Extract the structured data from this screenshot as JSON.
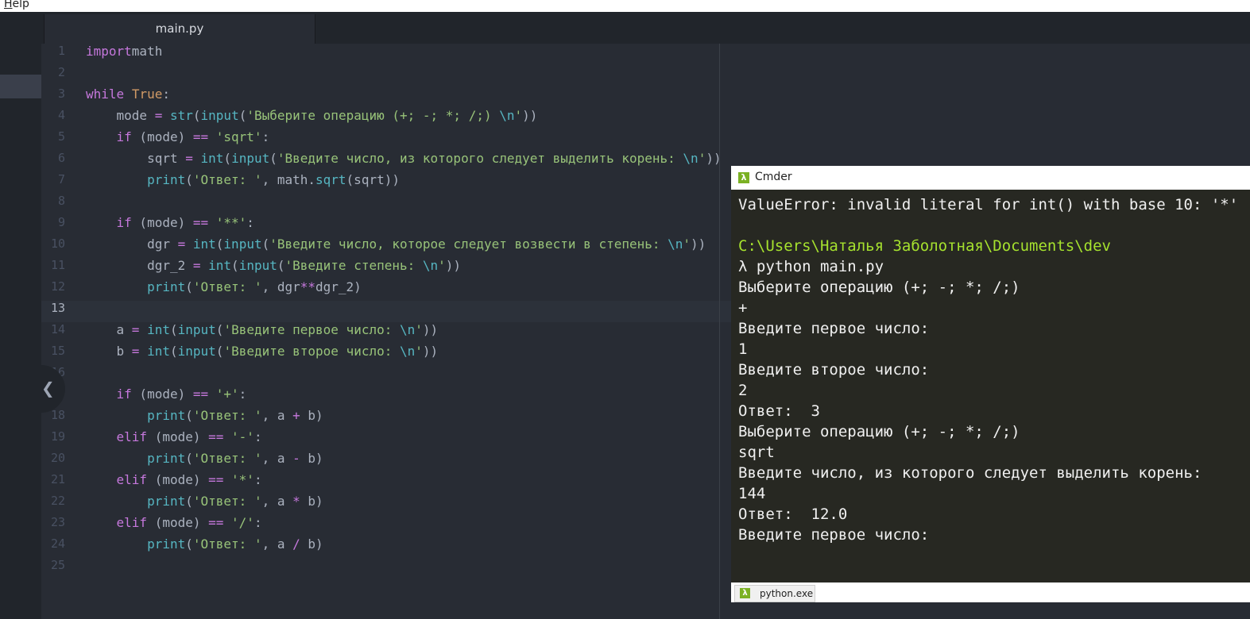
{
  "menubar": {
    "help_accel": "H",
    "help_rest": "elp"
  },
  "editor": {
    "tab_title": "main.py",
    "current_line": 13,
    "lines": [
      {
        "num": "1",
        "segs": [
          [
            "kw",
            "import"
          ],
          [
            "",
            "math"
          ]
        ]
      },
      {
        "num": "2",
        "segs": []
      },
      {
        "num": "3",
        "segs": [
          [
            "kw",
            "while"
          ],
          [
            "",
            " "
          ],
          [
            "cn",
            "True"
          ],
          [
            "",
            ":"
          ]
        ]
      },
      {
        "num": "4",
        "segs": [
          [
            "",
            "    mode "
          ],
          [
            "op",
            "="
          ],
          [
            "",
            " "
          ],
          [
            "bi",
            "str"
          ],
          [
            "",
            "("
          ],
          [
            "bi",
            "input"
          ],
          [
            "",
            "("
          ],
          [
            "st",
            "'Выберите операцию (+; -; *; /;) "
          ],
          [
            "es",
            "\\n"
          ],
          [
            "st",
            "'"
          ],
          [
            "",
            "))"
          ]
        ]
      },
      {
        "num": "5",
        "segs": [
          [
            "",
            "    "
          ],
          [
            "kw",
            "if"
          ],
          [
            "",
            " (mode) "
          ],
          [
            "op",
            "=="
          ],
          [
            "",
            " "
          ],
          [
            "st",
            "'sqrt'"
          ],
          [
            "",
            ":"
          ]
        ]
      },
      {
        "num": "6",
        "segs": [
          [
            "",
            "        sqrt "
          ],
          [
            "op",
            "="
          ],
          [
            "",
            " "
          ],
          [
            "bi",
            "int"
          ],
          [
            "",
            "("
          ],
          [
            "bi",
            "input"
          ],
          [
            "",
            "("
          ],
          [
            "st",
            "'Введите число, из которого следует выделить корень: "
          ],
          [
            "es",
            "\\n"
          ],
          [
            "st",
            "'"
          ],
          [
            "",
            "))"
          ]
        ]
      },
      {
        "num": "7",
        "segs": [
          [
            "",
            "        "
          ],
          [
            "bi",
            "print"
          ],
          [
            "",
            "("
          ],
          [
            "st",
            "'Ответ: '"
          ],
          [
            "",
            ", math."
          ],
          [
            "bi",
            "sqrt"
          ],
          [
            "",
            "(sqrt))"
          ]
        ]
      },
      {
        "num": "8",
        "segs": []
      },
      {
        "num": "9",
        "segs": [
          [
            "",
            "    "
          ],
          [
            "kw",
            "if"
          ],
          [
            "",
            " (mode) "
          ],
          [
            "op",
            "=="
          ],
          [
            "",
            " "
          ],
          [
            "st",
            "'**'"
          ],
          [
            "",
            ":"
          ]
        ]
      },
      {
        "num": "10",
        "segs": [
          [
            "",
            "        dgr "
          ],
          [
            "op",
            "="
          ],
          [
            "",
            " "
          ],
          [
            "bi",
            "int"
          ],
          [
            "",
            "("
          ],
          [
            "bi",
            "input"
          ],
          [
            "",
            "("
          ],
          [
            "st",
            "'Введите число, которое следует возвести в степень: "
          ],
          [
            "es",
            "\\n"
          ],
          [
            "st",
            "'"
          ],
          [
            "",
            "))"
          ]
        ]
      },
      {
        "num": "11",
        "segs": [
          [
            "",
            "        dgr_2 "
          ],
          [
            "op",
            "="
          ],
          [
            "",
            " "
          ],
          [
            "bi",
            "int"
          ],
          [
            "",
            "("
          ],
          [
            "bi",
            "input"
          ],
          [
            "",
            "("
          ],
          [
            "st",
            "'Введите степень: "
          ],
          [
            "es",
            "\\n"
          ],
          [
            "st",
            "'"
          ],
          [
            "",
            "))"
          ]
        ]
      },
      {
        "num": "12",
        "segs": [
          [
            "",
            "        "
          ],
          [
            "bi",
            "print"
          ],
          [
            "",
            "("
          ],
          [
            "st",
            "'Ответ: '"
          ],
          [
            "",
            ", dgr"
          ],
          [
            "op",
            "**"
          ],
          [
            "",
            "dgr_2)"
          ]
        ]
      },
      {
        "num": "13",
        "segs": []
      },
      {
        "num": "14",
        "segs": [
          [
            "",
            "    a "
          ],
          [
            "op",
            "="
          ],
          [
            "",
            " "
          ],
          [
            "bi",
            "int"
          ],
          [
            "",
            "("
          ],
          [
            "bi",
            "input"
          ],
          [
            "",
            "("
          ],
          [
            "st",
            "'Введите первое число: "
          ],
          [
            "es",
            "\\n"
          ],
          [
            "st",
            "'"
          ],
          [
            "",
            "))"
          ]
        ]
      },
      {
        "num": "15",
        "segs": [
          [
            "",
            "    b "
          ],
          [
            "op",
            "="
          ],
          [
            "",
            " "
          ],
          [
            "bi",
            "int"
          ],
          [
            "",
            "("
          ],
          [
            "bi",
            "input"
          ],
          [
            "",
            "("
          ],
          [
            "st",
            "'Введите вторoе число: "
          ],
          [
            "es",
            "\\n"
          ],
          [
            "st",
            "'"
          ],
          [
            "",
            "))"
          ]
        ]
      },
      {
        "num": "16",
        "segs": []
      },
      {
        "num": "17",
        "segs": [
          [
            "",
            "    "
          ],
          [
            "kw",
            "if"
          ],
          [
            "",
            " (mode) "
          ],
          [
            "op",
            "=="
          ],
          [
            "",
            " "
          ],
          [
            "st",
            "'+'"
          ],
          [
            "",
            ":"
          ]
        ]
      },
      {
        "num": "18",
        "segs": [
          [
            "",
            "        "
          ],
          [
            "bi",
            "print"
          ],
          [
            "",
            "("
          ],
          [
            "st",
            "'Ответ: '"
          ],
          [
            "",
            ", a "
          ],
          [
            "op",
            "+"
          ],
          [
            "",
            " b)"
          ]
        ]
      },
      {
        "num": "19",
        "segs": [
          [
            "",
            "    "
          ],
          [
            "kw",
            "elif"
          ],
          [
            "",
            " (mode) "
          ],
          [
            "op",
            "=="
          ],
          [
            "",
            " "
          ],
          [
            "st",
            "'-'"
          ],
          [
            "",
            ":"
          ]
        ]
      },
      {
        "num": "20",
        "segs": [
          [
            "",
            "        "
          ],
          [
            "bi",
            "print"
          ],
          [
            "",
            "("
          ],
          [
            "st",
            "'Ответ: '"
          ],
          [
            "",
            ", a "
          ],
          [
            "op",
            "-"
          ],
          [
            "",
            " b)"
          ]
        ]
      },
      {
        "num": "21",
        "segs": [
          [
            "",
            "    "
          ],
          [
            "kw",
            "elif"
          ],
          [
            "",
            " (mode) "
          ],
          [
            "op",
            "=="
          ],
          [
            "",
            " "
          ],
          [
            "st",
            "'*'"
          ],
          [
            "",
            ":"
          ]
        ]
      },
      {
        "num": "22",
        "segs": [
          [
            "",
            "        "
          ],
          [
            "bi",
            "print"
          ],
          [
            "",
            "("
          ],
          [
            "st",
            "'Ответ: '"
          ],
          [
            "",
            ", a "
          ],
          [
            "op",
            "*"
          ],
          [
            "",
            " b)"
          ]
        ]
      },
      {
        "num": "23",
        "segs": [
          [
            "",
            "    "
          ],
          [
            "kw",
            "elif"
          ],
          [
            "",
            " (mode) "
          ],
          [
            "op",
            "=="
          ],
          [
            "",
            " "
          ],
          [
            "st",
            "'/'"
          ],
          [
            "",
            ":"
          ]
        ]
      },
      {
        "num": "24",
        "segs": [
          [
            "",
            "        "
          ],
          [
            "bi",
            "print"
          ],
          [
            "",
            "("
          ],
          [
            "st",
            "'Ответ: '"
          ],
          [
            "",
            ", a "
          ],
          [
            "op",
            "/"
          ],
          [
            "",
            " b)"
          ]
        ]
      },
      {
        "num": "25",
        "segs": []
      }
    ]
  },
  "console": {
    "title": "Cmder",
    "icon_glyph": "λ",
    "output": [
      {
        "kind": "text",
        "text": "ValueError: invalid literal for int() with base 10: '*'"
      },
      {
        "kind": "text",
        "text": ""
      },
      {
        "kind": "path",
        "text": "C:\\Users\\Наталья Заболотная\\Documents\\dev"
      },
      {
        "kind": "text",
        "text": "λ python main.py"
      },
      {
        "kind": "text",
        "text": "Выберите операцию (+; -; *; /;)"
      },
      {
        "kind": "text",
        "text": "+"
      },
      {
        "kind": "text",
        "text": "Введите первое число:"
      },
      {
        "kind": "text",
        "text": "1"
      },
      {
        "kind": "text",
        "text": "Введите вторoе число:"
      },
      {
        "kind": "text",
        "text": "2"
      },
      {
        "kind": "text",
        "text": "Ответ:  3"
      },
      {
        "kind": "text",
        "text": "Выберите операцию (+; -; *; /;)"
      },
      {
        "kind": "text",
        "text": "sqrt"
      },
      {
        "kind": "text",
        "text": "Введите число, из которого следует выделить корень:"
      },
      {
        "kind": "text",
        "text": "144"
      },
      {
        "kind": "text",
        "text": "Ответ:  12.0"
      },
      {
        "kind": "text",
        "text": "Введите первое число:"
      }
    ],
    "status_tab": "python.exe"
  }
}
